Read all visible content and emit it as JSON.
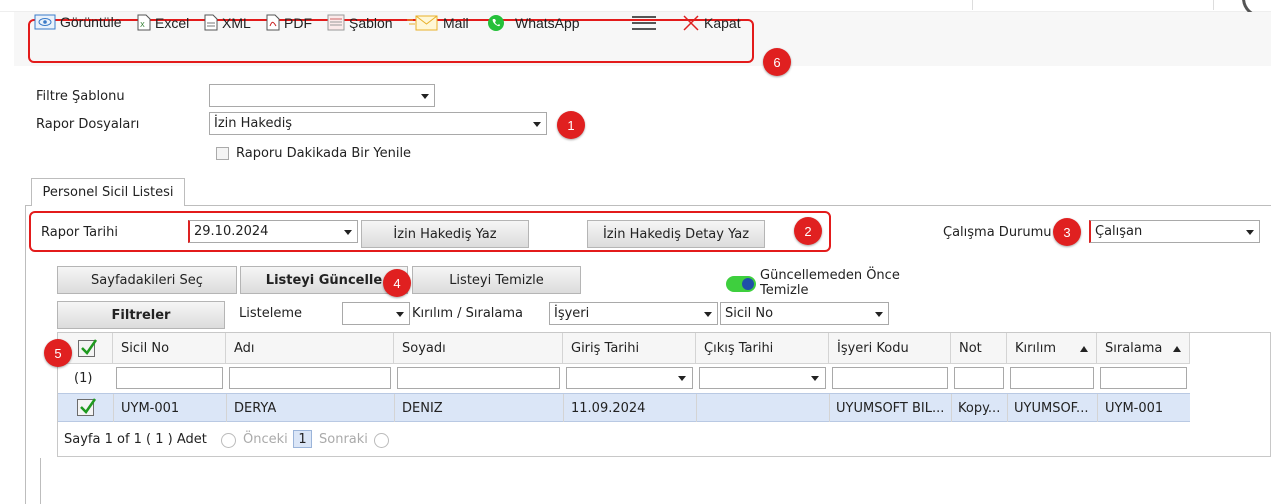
{
  "toolbar": {
    "view_label": "Görüntüle",
    "excel_label": "Excel",
    "xml_label": "XML",
    "pdf_label": "PDF",
    "template_label": "Şablon",
    "mail_label": "Mail",
    "whatsapp_label": "WhatsApp",
    "close_label": "Kapat"
  },
  "badges": [
    "1",
    "2",
    "3",
    "4",
    "5",
    "6"
  ],
  "form": {
    "filter_template_label": "Filtre Şablonu",
    "filter_template_value": "",
    "report_files_label": "Rapor Dosyaları",
    "report_files_value": "İzin Hakediş",
    "refresh_label": "Raporu Dakikada Bir Yenile"
  },
  "tab": {
    "label": "Personel Sicil Listesi"
  },
  "report": {
    "date_label": "Rapor Tarihi",
    "date_value": "29.10.2024",
    "btn_write": "İzin Hakediş Yaz",
    "btn_detail": "İzin Hakediş Detay Yaz",
    "status_label": "Çalışma Durumu",
    "status_value": "Çalışan"
  },
  "actions": {
    "select_page": "Sayfadakileri Seç",
    "update_list": "Listeyi Güncelle",
    "clear_list": "Listeyi Temizle",
    "toggle_label_line1": "Güncellemeden Önce",
    "toggle_label_line2": "Temizle",
    "filters": "Filtreler",
    "listing_label": "Listeleme",
    "listing_value": "",
    "breakdown_label": "Kırılım / Sıralama",
    "breakdown_value": "İşyeri",
    "sort_value": "Sicil No"
  },
  "grid": {
    "columns": [
      "Sicil No",
      "Adı",
      "Soyadı",
      "Giriş Tarihi",
      "Çıkış Tarihi",
      "İşyeri Kodu",
      "Not",
      "Kırılım",
      "Sıralama"
    ],
    "group_count": "(1)",
    "rows": [
      [
        "UYM-001",
        "DERYA",
        "DENİZ",
        "11.09.2024",
        "",
        "UYUMSOFT BİL...",
        "Kopy...",
        "UYUMSOF...",
        "UYM-001"
      ]
    ]
  },
  "pager": {
    "summary": "Sayfa 1 of 1 ( 1 ) Adet",
    "prev": "Önceki",
    "page": "1",
    "next": "Sonraki"
  },
  "colors": {
    "highlight_red": "#e31b1b",
    "selected_row": "#dbe6f7",
    "toggle_on": "#3ecf3e"
  }
}
